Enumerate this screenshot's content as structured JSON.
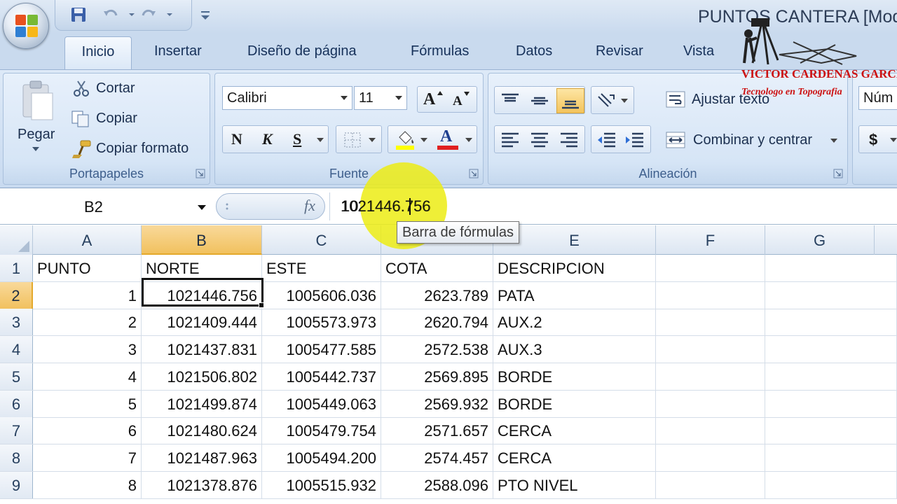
{
  "window_title": "PUNTOS CANTERA  [Modo",
  "tabs": [
    "Inicio",
    "Insertar",
    "Diseño de página",
    "Fórmulas",
    "Datos",
    "Revisar",
    "Vista"
  ],
  "clipboard": {
    "paste_label": "Pegar",
    "cut_label": "Cortar",
    "copy_label": "Copiar",
    "format_painter_label": "Copiar formato",
    "group_label": "Portapapeles"
  },
  "font_group": {
    "font_name": "Calibri",
    "font_size": "11",
    "bold_glyph": "N",
    "italic_glyph": "K",
    "underline_glyph": "S",
    "grow_glyph": "A",
    "shrink_glyph": "A",
    "font_color_glyph": "A",
    "group_label": "Fuente"
  },
  "alignment": {
    "wrap_label": "Ajustar texto",
    "merge_label": "Combinar y centrar",
    "group_label": "Alineación"
  },
  "number_group": {
    "format_label": "Núm",
    "currency_glyph": "$"
  },
  "watermark": {
    "name": "VICTOR CARDENAS GARCIA",
    "subtitle": "Tecnologo en Topografia"
  },
  "formula_bar": {
    "cell_ref": "B2",
    "fx_label": "fx",
    "value": "1021446.756",
    "tooltip": "Barra de fórmulas"
  },
  "columns": [
    "A",
    "B",
    "C",
    "",
    "E",
    "F",
    "G"
  ],
  "row_numbers": [
    "1",
    "2",
    "3",
    "4",
    "5",
    "6",
    "7",
    "8",
    "9"
  ],
  "rows": [
    [
      "PUNTO",
      "NORTE",
      "ESTE",
      "COTA",
      "DESCRIPCION"
    ],
    [
      "1",
      "1021446.756",
      "1005606.036",
      "2623.789",
      "PATA"
    ],
    [
      "2",
      "1021409.444",
      "1005573.973",
      "2620.794",
      "AUX.2"
    ],
    [
      "3",
      "1021437.831",
      "1005477.585",
      "2572.538",
      "AUX.3"
    ],
    [
      "4",
      "1021506.802",
      "1005442.737",
      "2569.895",
      "BORDE"
    ],
    [
      "5",
      "1021499.874",
      "1005449.063",
      "2569.932",
      "BORDE"
    ],
    [
      "6",
      "1021480.624",
      "1005479.754",
      "2571.657",
      "CERCA"
    ],
    [
      "7",
      "1021487.963",
      "1005494.200",
      "2574.457",
      "CERCA"
    ],
    [
      "8",
      "1021378.876",
      "1005515.932",
      "2588.096",
      "PTO NIVEL"
    ]
  ],
  "active_cell": "B2"
}
